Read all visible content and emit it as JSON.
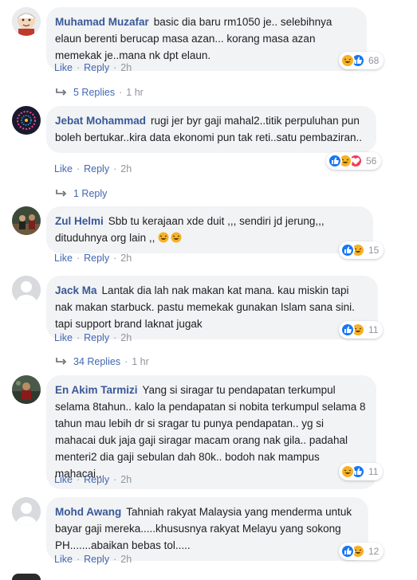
{
  "comments": [
    {
      "author": "Muhamad Muzafar",
      "text": "basic dia baru rm1050 je.. selebihnya elaun berenti berucap masa azan... korang masa azan memekak je..mana nk dpt elaun.",
      "like_label": "Like",
      "reply_label": "Reply",
      "time": "2h",
      "reactions": [
        "haha",
        "like"
      ],
      "reaction_count": "68",
      "replies": {
        "label": "5 Replies",
        "time": "1 hr"
      },
      "avatar": "cartoon-avatar"
    },
    {
      "author": "Jebat Mohammad",
      "text": "rugi jer byr gaji mahal2..titik perpuluhan pun boleh bertukar..kira data ekonomi pun tak reti..satu pembaziran..",
      "like_label": "Like",
      "reply_label": "Reply",
      "time": "2h",
      "reactions": [
        "like",
        "haha",
        "love"
      ],
      "reaction_count": "56",
      "replies": {
        "label": "1 Reply",
        "time": ""
      },
      "avatar": "dark-circle-avatar"
    },
    {
      "author": "Zul Helmi",
      "text": "Sbb tu kerajaan xde duit ,,, sendiri jd jerung,,, dituduhnya org lain ,,",
      "emoji_tail": [
        "haha",
        "haha"
      ],
      "like_label": "Like",
      "reply_label": "Reply",
      "time": "2h",
      "reactions": [
        "like",
        "haha"
      ],
      "reaction_count": "15",
      "avatar": "photo-avatar"
    },
    {
      "author": "Jack Ma",
      "text": "Lantak dia lah nak makan kat mana. kau miskin tapi nak makan starbuck. pastu memekak gunakan Islam sana sini. tapi support brand laknat jugak",
      "like_label": "Like",
      "reply_label": "Reply",
      "time": "2h",
      "reactions": [
        "like",
        "haha"
      ],
      "reaction_count": "11",
      "replies": {
        "label": "34 Replies",
        "time": "1 hr"
      },
      "avatar": "default-avatar"
    },
    {
      "author": "En Akim Tarmizi",
      "text": "Yang si siragar tu pendapatan terkumpul selama 8tahun.. kalo la pendapatan si nobita terkumpul selama 8 tahun mau lebih dr si sragar tu punya pendapatan.. yg si mahacai duk jaja gaji siragar macam orang nak gila.. padahal menteri2 dia gaji sebulan dah 80k.. bodoh nak mampus mahacai..",
      "like_label": "Like",
      "reply_label": "Reply",
      "time": "2h",
      "reactions": [
        "haha",
        "like"
      ],
      "reaction_count": "11",
      "avatar": "photo-avatar-2"
    },
    {
      "author": "Mohd Awang",
      "text": "Tahniah rakyat Malaysia yang menderma untuk bayar gaji mereka.....khususnya rakyat Melayu yang sokong PH.......abaikan bebas tol.....",
      "like_label": "Like",
      "reply_label": "Reply",
      "time": "2h",
      "reactions": [
        "like",
        "haha"
      ],
      "reaction_count": "12",
      "avatar": "default-avatar"
    }
  ],
  "colors": {
    "link": "#4267b2",
    "author": "#385898",
    "bubble": "#f2f3f5",
    "meta": "#90949c",
    "like": "#1877f2",
    "haha": "#f7b125",
    "love": "#f33e58"
  }
}
